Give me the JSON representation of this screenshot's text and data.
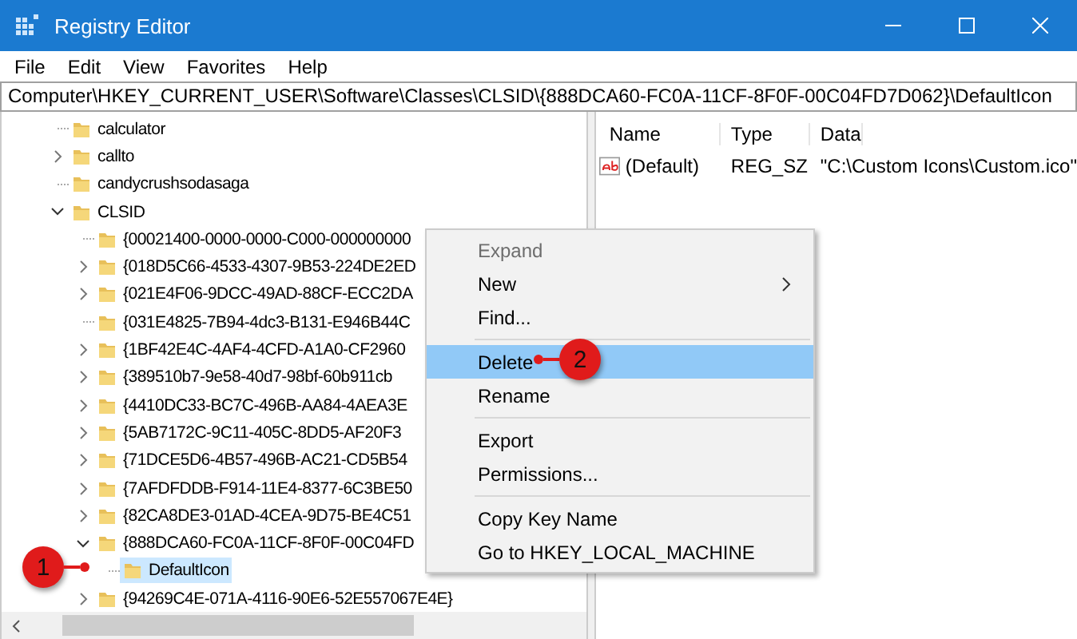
{
  "window": {
    "title": "Registry Editor"
  },
  "menu_bar": [
    "File",
    "Edit",
    "View",
    "Favorites",
    "Help"
  ],
  "address_bar": {
    "value": "Computer\\HKEY_CURRENT_USER\\Software\\Classes\\CLSID\\{888DCA60-FC0A-11CF-8F0F-00C04FD7D062}\\DefaultIcon"
  },
  "tree": [
    {
      "label": "calculator",
      "has_children": false,
      "selected": false
    },
    {
      "label": "callto",
      "has_children": true,
      "expanded": false,
      "selected": false
    },
    {
      "label": "candycrushsodasaga",
      "has_children": false,
      "selected": false
    },
    {
      "label": "CLSID",
      "has_children": true,
      "expanded": true,
      "selected": false,
      "children": [
        {
          "label": "{00021400-0000-0000-C000-000000000",
          "has_children": false,
          "selected": false
        },
        {
          "label": "{018D5C66-4533-4307-9B53-224DE2ED",
          "has_children": true,
          "expanded": false,
          "selected": false
        },
        {
          "label": "{021E4F06-9DCC-49AD-88CF-ECC2DA",
          "has_children": true,
          "expanded": false,
          "selected": false
        },
        {
          "label": "{031E4825-7B94-4dc3-B131-E946B44C",
          "has_children": false,
          "selected": false
        },
        {
          "label": "{1BF42E4C-4AF4-4CFD-A1A0-CF2960",
          "has_children": true,
          "expanded": false,
          "selected": false
        },
        {
          "label": "{389510b7-9e58-40d7-98bf-60b911cb",
          "has_children": true,
          "expanded": false,
          "selected": false
        },
        {
          "label": "{4410DC33-BC7C-496B-AA84-4AEA3E",
          "has_children": true,
          "expanded": false,
          "selected": false
        },
        {
          "label": "{5AB7172C-9C11-405C-8DD5-AF20F3",
          "has_children": true,
          "expanded": false,
          "selected": false
        },
        {
          "label": "{71DCE5D6-4B57-496B-AC21-CD5B54",
          "has_children": true,
          "expanded": false,
          "selected": false
        },
        {
          "label": "{7AFDFDDB-F914-11E4-8377-6C3BE50",
          "has_children": true,
          "expanded": false,
          "selected": false
        },
        {
          "label": "{82CA8DE3-01AD-4CEA-9D75-BE4C51",
          "has_children": true,
          "expanded": false,
          "selected": false
        },
        {
          "label": "{888DCA60-FC0A-11CF-8F0F-00C04FD",
          "has_children": true,
          "expanded": true,
          "selected": false,
          "children": [
            {
              "label": "DefaultIcon",
              "has_children": false,
              "selected": true
            }
          ]
        },
        {
          "label": "{94269C4E-071A-4116-90E6-52E557067E4E}",
          "has_children": true,
          "expanded": false,
          "selected": false
        }
      ]
    }
  ],
  "values_table": {
    "columns": [
      "Name",
      "Type",
      "Data"
    ],
    "rows": [
      {
        "name": "(Default)",
        "type": "REG_SZ",
        "data": "\"C:\\Custom Icons\\Custom.ico\""
      }
    ]
  },
  "context_menu": [
    {
      "kind": "item",
      "label": "Expand",
      "disabled": true,
      "selected": false,
      "submenu": false
    },
    {
      "kind": "item",
      "label": "New",
      "disabled": false,
      "selected": false,
      "submenu": true
    },
    {
      "kind": "item",
      "label": "Find...",
      "disabled": false,
      "selected": false,
      "submenu": false
    },
    {
      "kind": "separator"
    },
    {
      "kind": "item",
      "label": "Delete",
      "disabled": false,
      "selected": true,
      "submenu": false
    },
    {
      "kind": "item",
      "label": "Rename",
      "disabled": false,
      "selected": false,
      "submenu": false
    },
    {
      "kind": "separator"
    },
    {
      "kind": "item",
      "label": "Export",
      "disabled": false,
      "selected": false,
      "submenu": false
    },
    {
      "kind": "item",
      "label": "Permissions...",
      "disabled": false,
      "selected": false,
      "submenu": false
    },
    {
      "kind": "separator"
    },
    {
      "kind": "item",
      "label": "Copy Key Name",
      "disabled": false,
      "selected": false,
      "submenu": false
    },
    {
      "kind": "item",
      "label": "Go to HKEY_LOCAL_MACHINE",
      "disabled": false,
      "selected": false,
      "submenu": false
    }
  ],
  "callouts": [
    "1",
    "2"
  ]
}
